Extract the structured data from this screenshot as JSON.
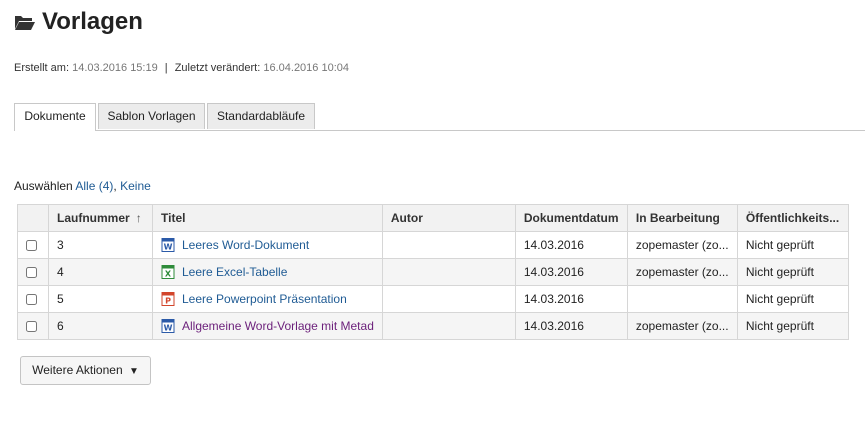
{
  "page": {
    "title": "Vorlagen",
    "created_label": "Erstellt am:",
    "created_value": "14.03.2016 15:19",
    "separator": "|",
    "modified_label": "Zuletzt verändert:",
    "modified_value": "16.04.2016 10:04"
  },
  "tabs": [
    {
      "label": "Dokumente",
      "active": true
    },
    {
      "label": "Sablon Vorlagen",
      "active": false
    },
    {
      "label": "Standardabläufe",
      "active": false
    }
  ],
  "selection": {
    "label": "Auswählen",
    "all_link": "Alle (4)",
    "comma": ",",
    "none_link": "Keine"
  },
  "table": {
    "headers": [
      "Laufnummer",
      "Titel",
      "Autor",
      "Dokumentdatum",
      "In Bearbeitung",
      "Öffentlichkeits..."
    ],
    "sort_indicator": "↑",
    "rows": [
      {
        "number": "3",
        "title": "Leeres Word-Dokument",
        "icon": "word-icon",
        "author": "",
        "date": "14.03.2016",
        "editing": "zopemaster (zo...",
        "public": "Nicht geprüft"
      },
      {
        "number": "4",
        "title": "Leere Excel-Tabelle",
        "icon": "excel-icon",
        "author": "",
        "date": "14.03.2016",
        "editing": "zopemaster (zo...",
        "public": "Nicht geprüft"
      },
      {
        "number": "5",
        "title": "Leere Powerpoint Präsentation",
        "icon": "powerpoint-icon",
        "author": "",
        "date": "14.03.2016",
        "editing": "",
        "public": "Nicht geprüft"
      },
      {
        "number": "6",
        "title": "Allgemeine Word-Vorlage mit Metad",
        "icon": "word-icon",
        "author": "",
        "date": "14.03.2016",
        "editing": "zopemaster (zo...",
        "public": "Nicht geprüft"
      }
    ]
  },
  "actions": {
    "more_label": "Weitere Aktionen",
    "more_arrow": "▼"
  },
  "colors": {
    "link": "#1f5b94",
    "visited_link": "#6b1f7a",
    "word": "#2b5aa8",
    "excel": "#2e8b3a",
    "powerpoint": "#d2452b"
  }
}
